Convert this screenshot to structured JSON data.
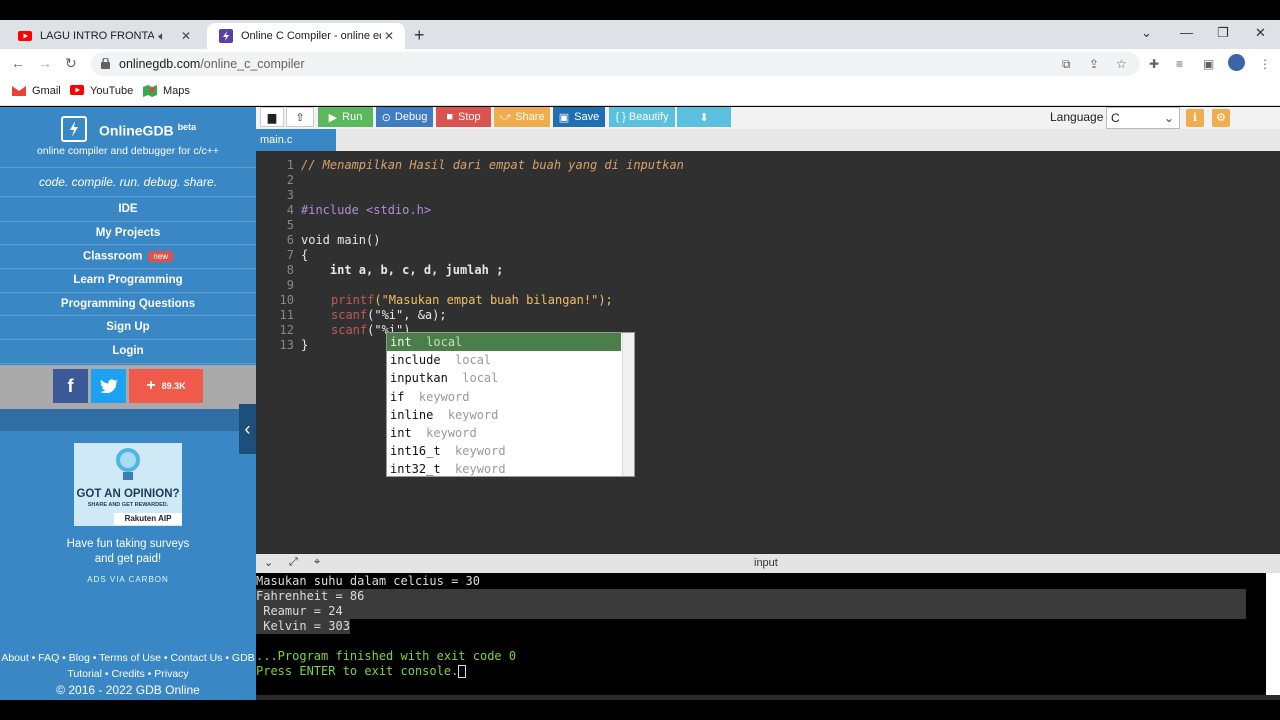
{
  "browser": {
    "tabs": [
      {
        "title": "LAGU INTRO FRONTAL GAM",
        "icon": "youtube-icon"
      },
      {
        "title": "Online C Compiler - online editor",
        "icon": "onlinegdb-icon"
      }
    ],
    "url_host": "onlinegdb.com",
    "url_path": "/online_c_compiler",
    "bookmarks": [
      "Gmail",
      "YouTube",
      "Maps"
    ]
  },
  "sidebar": {
    "brand": "OnlineGDB",
    "brand_sup": "beta",
    "subtitle": "online compiler and debugger for c/c++",
    "motto": "code. compile. run. debug. share.",
    "menu": [
      "IDE",
      "My Projects",
      "Classroom",
      "Learn Programming",
      "Programming Questions",
      "Sign Up",
      "Login"
    ],
    "classroom_badge": "new",
    "share_count": "89.3K",
    "ad": {
      "headline": "GOT AN OPINION?",
      "tagline": "SHARE AND GET REWARDED.",
      "brand": "Rakuten AIP"
    },
    "ad_text_1": "Have fun taking surveys",
    "ad_text_2": "and get paid!",
    "ads_via": "ADS VIA CARBON",
    "footer_line1": "About • FAQ • Blog • Terms of Use • Contact Us • GDB",
    "footer_line2": "Tutorial • Credits • Privacy",
    "copyright": "© 2016 - 2022 GDB Online"
  },
  "toolbar": {
    "run": "Run",
    "debug": "Debug",
    "stop": "Stop",
    "share": "Share",
    "save": "Save",
    "beautify": "{ } Beautify",
    "language_label": "Language",
    "language_value": "C"
  },
  "editor": {
    "file_tab": "main.c",
    "line_numbers": [
      "1",
      "2",
      "3",
      "4",
      "5",
      "6",
      "7",
      "8",
      "9",
      "10",
      "11",
      "12",
      "13"
    ],
    "lines": {
      "l1": "// Menampilkan Hasil dari empat buah yang di inputkan",
      "l4": "#include <stdio.h>",
      "l6": "void main()",
      "l7": "{",
      "l8": "    int a, b, c, d, jumlah ;",
      "l10_fn": "printf",
      "l10_rest": "(\"Masukan empat buah bilangan!\");",
      "l11_fn": "scanf",
      "l11_rest": "(\"%i\", &a);",
      "l12_fn": "scanf",
      "l12_rest": "(\"%i\")",
      "l13": "}"
    },
    "autocomplete": [
      {
        "word": "int",
        "meta": "local"
      },
      {
        "word": "include",
        "meta": "local"
      },
      {
        "word": "inputkan",
        "meta": "local"
      },
      {
        "word": "if",
        "meta": "keyword"
      },
      {
        "word": "inline",
        "meta": "keyword"
      },
      {
        "word": "int",
        "meta": "keyword"
      },
      {
        "word": "int16_t",
        "meta": "keyword"
      },
      {
        "word": "int32_t",
        "meta": "keyword"
      }
    ]
  },
  "console": {
    "header": "input",
    "lines": [
      "Masukan suhu dalam celcius = 30",
      "Fahrenheit = 86",
      " Reamur = 24",
      " Kelvin = 303",
      "",
      "...Program finished with exit code 0",
      "Press ENTER to exit console."
    ]
  },
  "colors": {
    "sidebar": "#3a87c6",
    "run": "#5cb85c",
    "stop": "#d9534f",
    "share": "#f0ad4e",
    "save": "#1f6fb2",
    "beautify": "#5bc0de"
  }
}
